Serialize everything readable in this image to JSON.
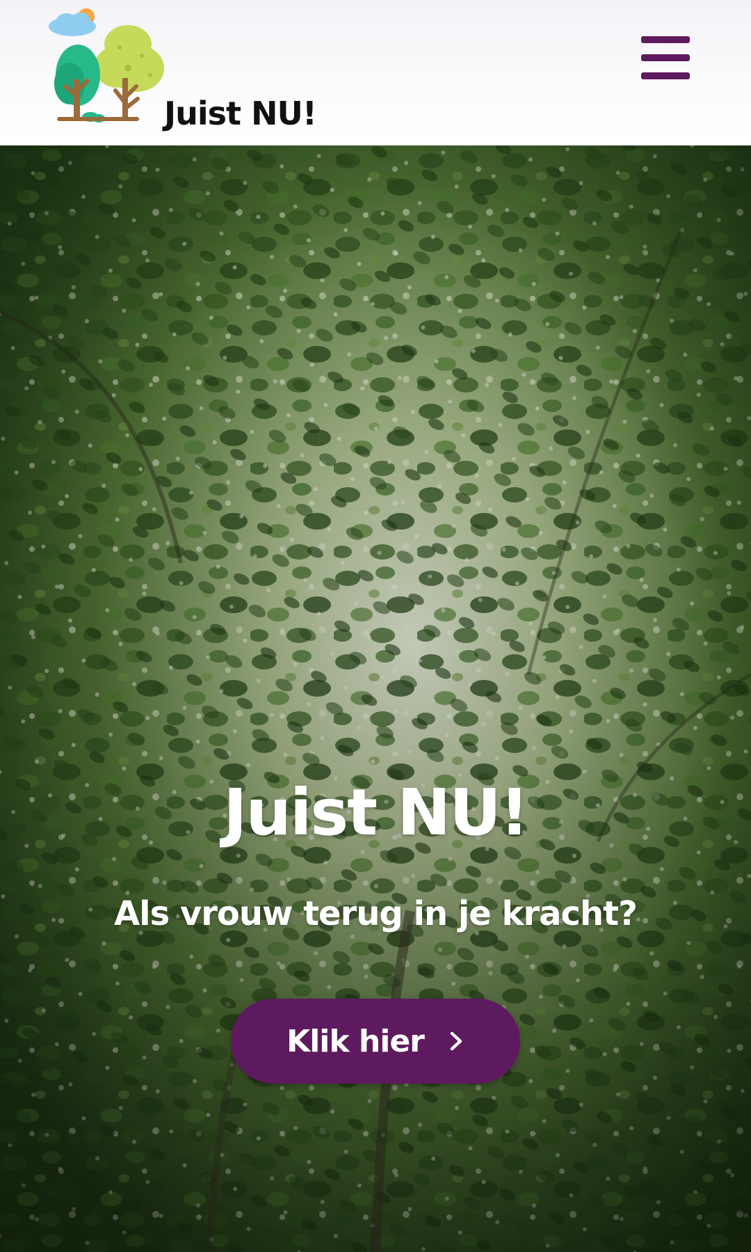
{
  "header": {
    "brand": "Juist NU!",
    "logo_icon": "trees-logo-icon",
    "menu_icon": "hamburger-menu-icon"
  },
  "hero": {
    "title": "Juist NU!",
    "subtitle": "Als vrouw terug in je kracht?",
    "cta_label": "Klik hier",
    "cta_icon": "chevron-right-icon",
    "background": "forest-canopy-photo"
  },
  "colors": {
    "accent": "#5e1a5e",
    "header_bg": "#f6f5f9",
    "foliage_dark": "#24401a",
    "foliage_light": "#8fa86a"
  }
}
